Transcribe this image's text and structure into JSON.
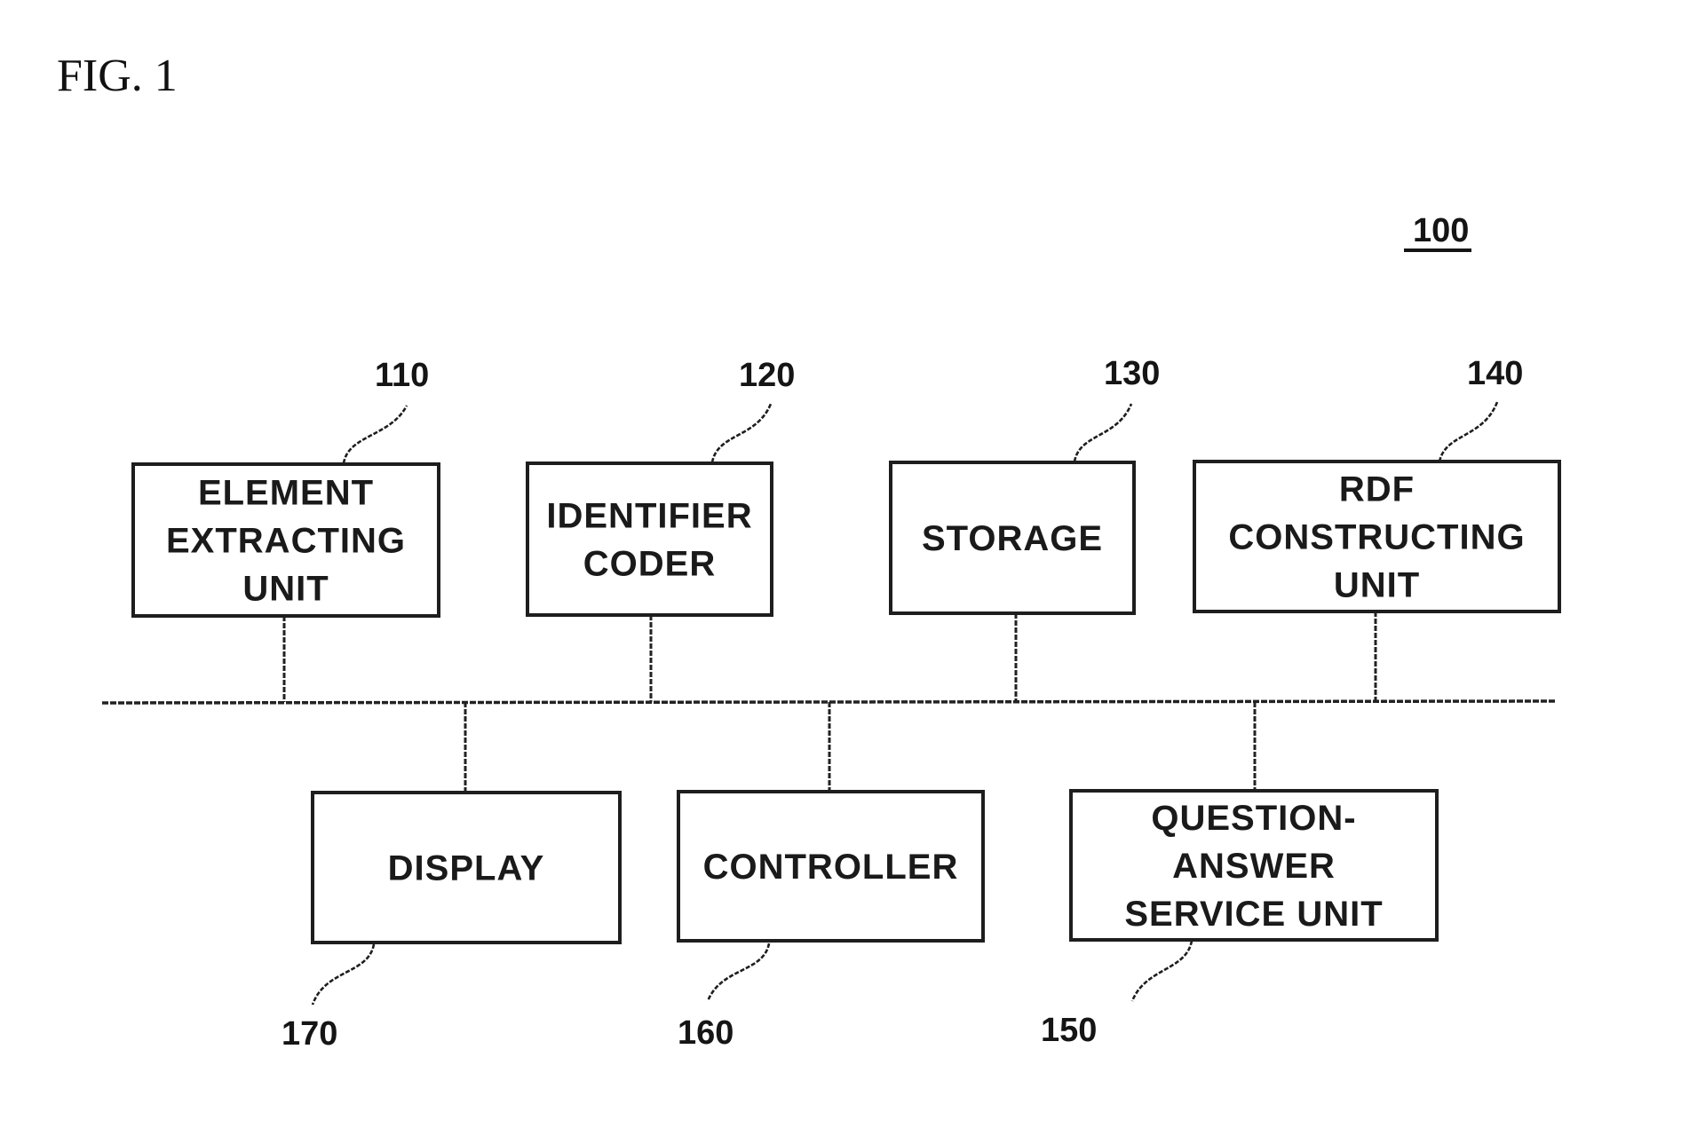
{
  "figure": {
    "title": "FIG. 1",
    "system_ref": "100"
  },
  "blocks": [
    {
      "id": "element-extracting-unit",
      "ref": "110",
      "lines": [
        "ELEMENT",
        "EXTRACTING",
        "UNIT"
      ],
      "row": "top"
    },
    {
      "id": "identifier-coder",
      "ref": "120",
      "lines": [
        "IDENTIFIER",
        "CODER"
      ],
      "row": "top"
    },
    {
      "id": "storage",
      "ref": "130",
      "lines": [
        "STORAGE"
      ],
      "row": "top"
    },
    {
      "id": "rdf-constructing-unit",
      "ref": "140",
      "lines": [
        "RDF",
        "CONSTRUCTING",
        "UNIT"
      ],
      "row": "top"
    },
    {
      "id": "display",
      "ref": "170",
      "lines": [
        "DISPLAY"
      ],
      "row": "bottom"
    },
    {
      "id": "controller",
      "ref": "160",
      "lines": [
        "CONTROLLER"
      ],
      "row": "bottom"
    },
    {
      "id": "question-answer-service-unit",
      "ref": "150",
      "lines": [
        "QUESTION-",
        "ANSWER",
        "SERVICE UNIT"
      ],
      "row": "bottom"
    }
  ],
  "connections": [
    {
      "from": "element-extracting-unit",
      "to": "bus"
    },
    {
      "from": "identifier-coder",
      "to": "bus"
    },
    {
      "from": "storage",
      "to": "bus"
    },
    {
      "from": "rdf-constructing-unit",
      "to": "bus"
    },
    {
      "from": "display",
      "to": "bus"
    },
    {
      "from": "controller",
      "to": "bus"
    },
    {
      "from": "question-answer-service-unit",
      "to": "bus"
    }
  ]
}
